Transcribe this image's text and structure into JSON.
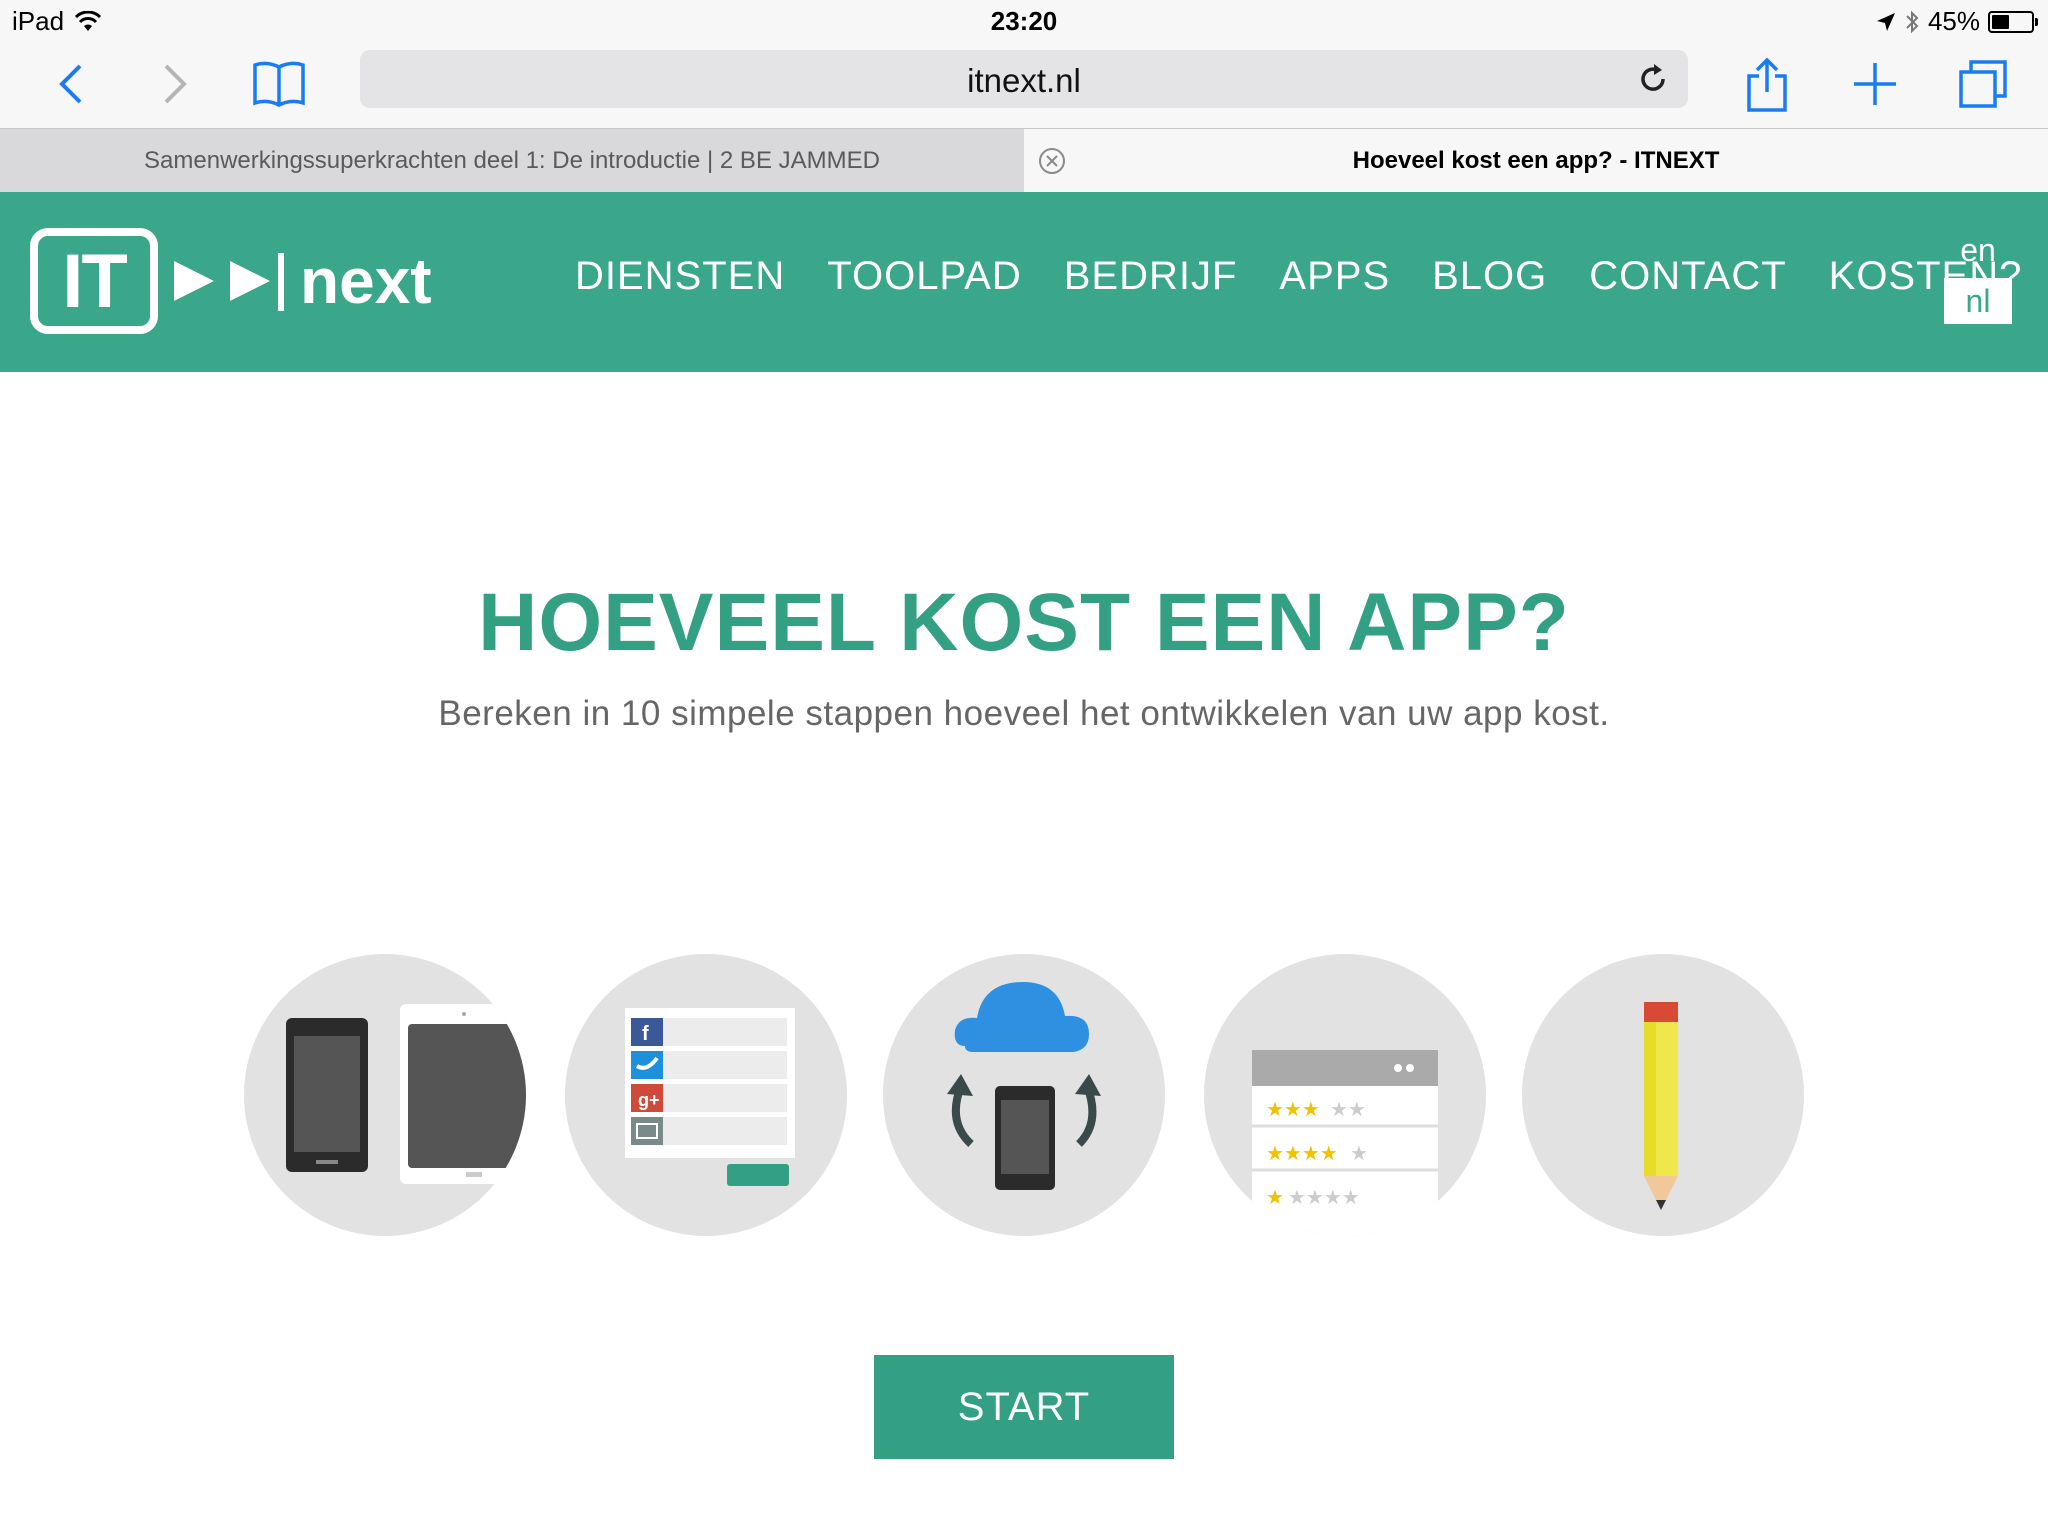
{
  "status_bar": {
    "device": "iPad",
    "time": "23:20",
    "battery": "45%",
    "battery_level": 0.45
  },
  "toolbar": {
    "url": "itnext.nl"
  },
  "tabs": [
    {
      "title": "Samenwerkingssuperkrachten deel 1: De introductie | 2 BE JAMMED",
      "active": false
    },
    {
      "title": "Hoeveel kost een app? - ITNEXT",
      "active": true
    }
  ],
  "site": {
    "logo": {
      "box_text": "IT",
      "suffix": "next"
    },
    "nav": [
      "DIENSTEN",
      "TOOLPAD",
      "BEDRIJF",
      "APPS",
      "BLOG",
      "CONTACT",
      "KOSTEN?"
    ],
    "languages": {
      "en": "en",
      "nl": "nl"
    }
  },
  "hero": {
    "title": "HOEVEEL KOST EEN APP?",
    "subtitle": "Bereken in 10 simpele stappen hoeveel het ontwikkelen van uw app kost."
  },
  "steps": [
    {
      "icon": "devices-icon"
    },
    {
      "icon": "social-login-icon"
    },
    {
      "icon": "cloud-sync-icon"
    },
    {
      "icon": "ratings-icon"
    },
    {
      "icon": "pencil-icon"
    }
  ],
  "cta": {
    "label": "START"
  },
  "colors": {
    "brand_green": "#3aa68a",
    "title_green": "#33a083",
    "ios_blue": "#1a7cf2"
  }
}
